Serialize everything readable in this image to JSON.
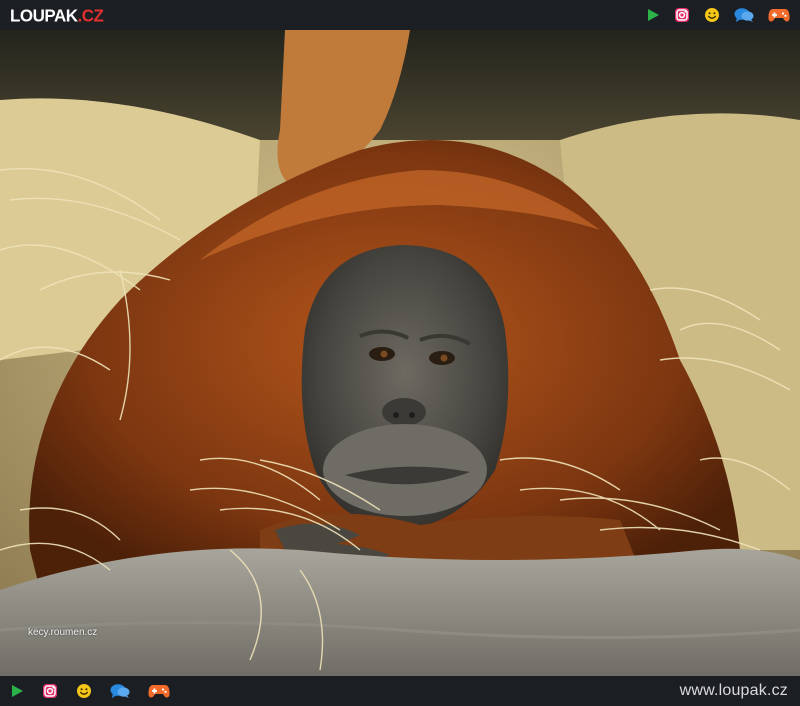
{
  "header": {
    "logo_main": "LOUPAK",
    "logo_tld": ".CZ"
  },
  "icons": [
    "play-icon",
    "instagram-icon",
    "smiley-icon",
    "chat-icon",
    "gamepad-icon"
  ],
  "colors": {
    "bar": "#1b1e23",
    "play": "#2bb34a",
    "instagram": "#e1306c",
    "smiley": "#f5c518",
    "chat": "#2a8ae0",
    "gamepad": "#f26b2a",
    "logo_tld": "#e2302f"
  },
  "photo": {
    "watermark": "kecy.roumen.cz"
  },
  "footer": {
    "site_url": "www.loupak.cz"
  }
}
